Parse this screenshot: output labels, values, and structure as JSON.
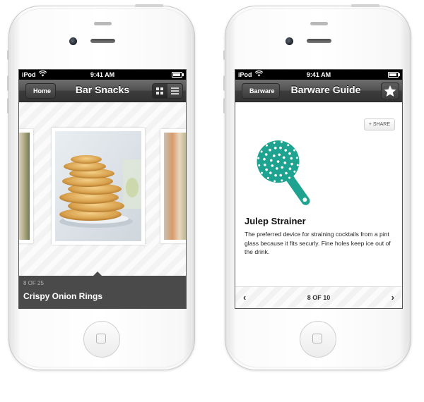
{
  "phones": [
    {
      "status": {
        "carrier": "iPod",
        "time": "9:41 AM"
      },
      "nav": {
        "back_label": "Home",
        "title": "Bar Snacks"
      },
      "caption": {
        "counter": "8 OF 25",
        "title": "Crispy Onion Rings"
      }
    },
    {
      "status": {
        "carrier": "iPod",
        "time": "9:41 AM"
      },
      "nav": {
        "back_label": "Barware",
        "title": "Barware Guide"
      },
      "share_label": "+ SHARE",
      "item": {
        "title": "Julep Strainer",
        "description": "The preferred device for straining cocktails from a pint glass because it fits securly. Fine holes keep ice out of the drink."
      },
      "pager": {
        "prev": "‹",
        "next": "›",
        "count": "8 OF 10"
      }
    }
  ],
  "icons": {
    "wifi": "wifi-icon",
    "battery": "battery-icon",
    "grid": "grid-view-icon",
    "list": "list-view-icon",
    "star": "star-icon",
    "strainer": "julep-strainer-icon"
  },
  "colors": {
    "accent_teal": "#1fa391",
    "navbar": "#3c3c3c",
    "caption_bar": "#4a4a4a"
  }
}
